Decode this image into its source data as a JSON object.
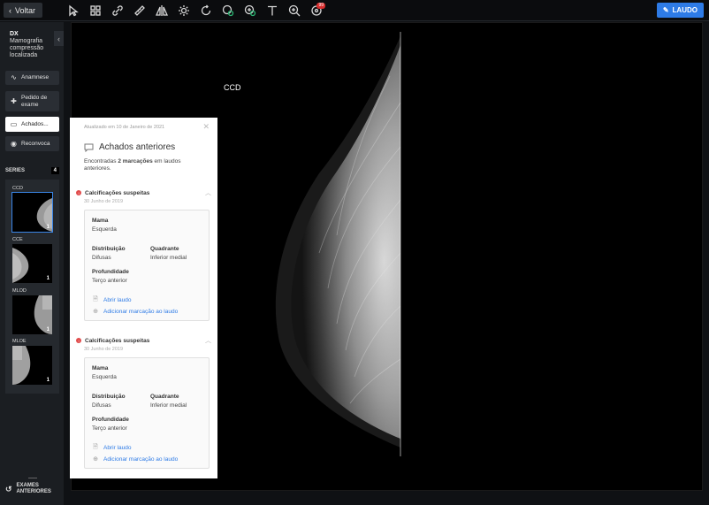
{
  "topbar": {
    "back_label": "Voltar",
    "tools": [
      "select-arrow-icon",
      "layout-grid-icon",
      "link-icon",
      "ruler-icon",
      "flip-icon",
      "brightness-icon",
      "rotate-icon",
      "pan-icon",
      "magnify-icon",
      "text-icon",
      "zoom-in-icon",
      "notifications-icon"
    ],
    "notif_count": "99",
    "laudo_label": "LAUDO"
  },
  "sidebar": {
    "modality": "DX",
    "study": "Mamografia compressão localizada",
    "buttons": [
      {
        "label": "Anamnese",
        "icon": "pulse-icon"
      },
      {
        "label": "Pedido de exame",
        "icon": "medical-cross-icon"
      },
      {
        "label": "Achados...",
        "icon": "comment-icon"
      },
      {
        "label": "Reconvoca",
        "icon": "recall-icon"
      }
    ],
    "series_label": "SERIES",
    "series_count": "4",
    "series": [
      {
        "label": "CCD",
        "count": "1"
      },
      {
        "label": "CCE",
        "count": "1"
      },
      {
        "label": "MLOD",
        "count": "1"
      },
      {
        "label": "MLOE",
        "count": "1"
      }
    ],
    "exames_label": "EXAMES ANTERIORES"
  },
  "viewer": {
    "view_label": "CCD"
  },
  "panel": {
    "updated": "Atualizado em 10 de Janeiro de 2021",
    "title": "Achados anteriores",
    "subtitle_pre": "Encontradas ",
    "subtitle_bold": "2 marcações",
    "subtitle_post": " em laudos anteriores.",
    "findings": [
      {
        "title": "Calcificações suspeitas",
        "date": "30 Junho de 2019",
        "mama_label": "Mama",
        "mama_value": "Esquerda",
        "dist_label": "Distribuição",
        "dist_value": "Difusas",
        "quad_label": "Quadrante",
        "quad_value": "Inferior medial",
        "prof_label": "Profundidade",
        "prof_value": "Terço anterior",
        "open_label": "Abrir laudo",
        "add_label": "Adicionar marcação ao laudo"
      },
      {
        "title": "Calcificações suspeitas",
        "date": "30 Junho de 2019",
        "mama_label": "Mama",
        "mama_value": "Esquerda",
        "dist_label": "Distribuição",
        "dist_value": "Difusas",
        "quad_label": "Quadrante",
        "quad_value": "Inferior medial",
        "prof_label": "Profundidade",
        "prof_value": "Terço anterior",
        "open_label": "Abrir laudo",
        "add_label": "Adicionar marcação ao laudo"
      }
    ]
  }
}
